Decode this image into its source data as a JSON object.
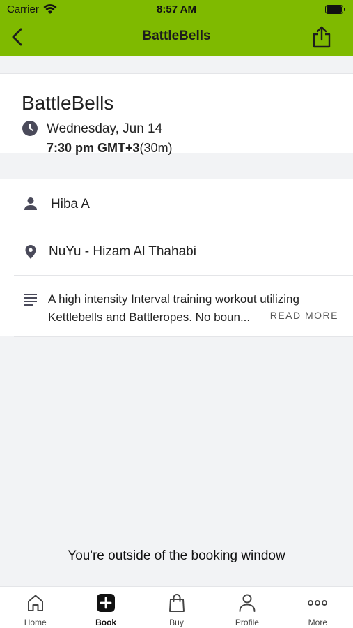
{
  "status": {
    "carrier": "Carrier",
    "time": "8:57 AM"
  },
  "nav": {
    "title": "BattleBells"
  },
  "class": {
    "title": "BattleBells",
    "date": "Wednesday, Jun 14",
    "time_bold": "7:30 pm GMT+3",
    "duration": "(30m)"
  },
  "details": {
    "instructor": "Hiba A",
    "location": "NuYu - Hizam Al Thahabi",
    "description_line1": "A high intensity Interval training workout utilizing",
    "description_line2": "Kettlebells and Battleropes. No boun...",
    "read_more": "READ MORE"
  },
  "booking_message": "You're outside of the booking window",
  "tabs": [
    {
      "label": "Home",
      "icon": "home-icon"
    },
    {
      "label": "Book",
      "icon": "plus-square-icon"
    },
    {
      "label": "Buy",
      "icon": "shopping-bag-icon"
    },
    {
      "label": "Profile",
      "icon": "person-icon"
    },
    {
      "label": "More",
      "icon": "more-dots-icon"
    }
  ],
  "colors": {
    "header": "#7fba00",
    "icon": "#4a4a5a"
  }
}
